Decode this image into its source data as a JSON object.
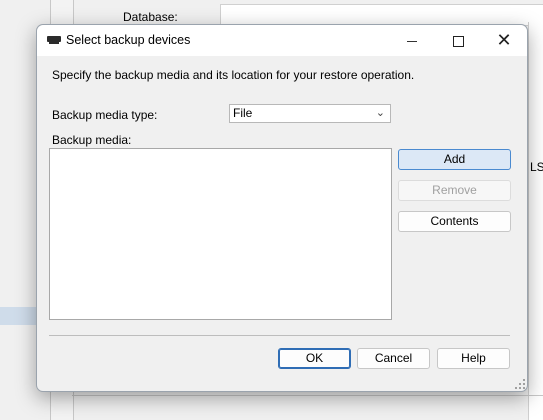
{
  "background": {
    "database_label": "Database:",
    "clipped_text": "LS"
  },
  "dialog": {
    "title": "Select backup devices",
    "instructions": "Specify the backup media and its location for your restore operation.",
    "media_type_label": "Backup media type:",
    "media_type_value": "File",
    "media_label": "Backup media:",
    "media_items": [],
    "buttons": {
      "add": "Add",
      "remove": "Remove",
      "contents": "Contents",
      "ok": "OK",
      "cancel": "Cancel",
      "help": "Help"
    }
  },
  "icons": {
    "app": "backup-device-icon",
    "minimize": "minimize-icon",
    "maximize": "maximize-icon",
    "close": "close-icon",
    "dropdown": "chevron-down-icon",
    "resize": "resize-grip-icon"
  },
  "colors": {
    "default_button_border": "#2f6db5",
    "focused_button_fill": "#dce8f6",
    "disabled_text": "#a0a0a0"
  }
}
